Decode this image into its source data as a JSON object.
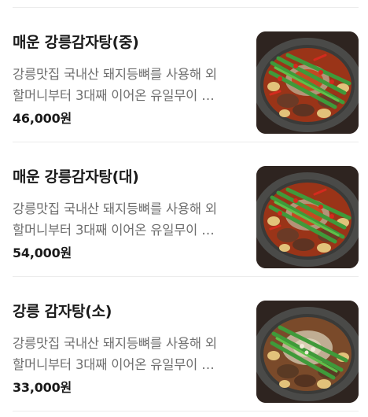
{
  "menu": {
    "items": [
      {
        "name": "매운 강릉감자탕(중)",
        "desc_line1": "강릉맛집 국내산 돼지등뼈를 사용해 외",
        "desc_line2": "할머니부터 3대째 이어온 유일무이 …",
        "price": "46,000원",
        "image_icon": "spicy-gamjatang-photo"
      },
      {
        "name": "매운 강릉감자탕(대)",
        "desc_line1": "강릉맛집 국내산 돼지등뼈를 사용해 외",
        "desc_line2": "할머니부터 3대째 이어온 유일무이 …",
        "price": "54,000원",
        "image_icon": "spicy-gamjatang-photo"
      },
      {
        "name": "강릉 감자탕(소)",
        "desc_line1": "강릉맛집 국내산 돼지등뼈를 사용해 외",
        "desc_line2": "할머니부터 3대째 이어온 유일무이 …",
        "price": "33,000원",
        "image_icon": "gamjatang-photo"
      }
    ]
  },
  "colors": {
    "text_primary": "#1a1a1a",
    "text_secondary": "#6e6e6e",
    "divider": "#ececec",
    "pot": "#4a4a48",
    "broth_spicy": "#9a3418",
    "broth_mild": "#7a4a2a",
    "scallion": "#3f9a3a",
    "potato": "#e2c27a",
    "chili": "#d42a1e"
  }
}
